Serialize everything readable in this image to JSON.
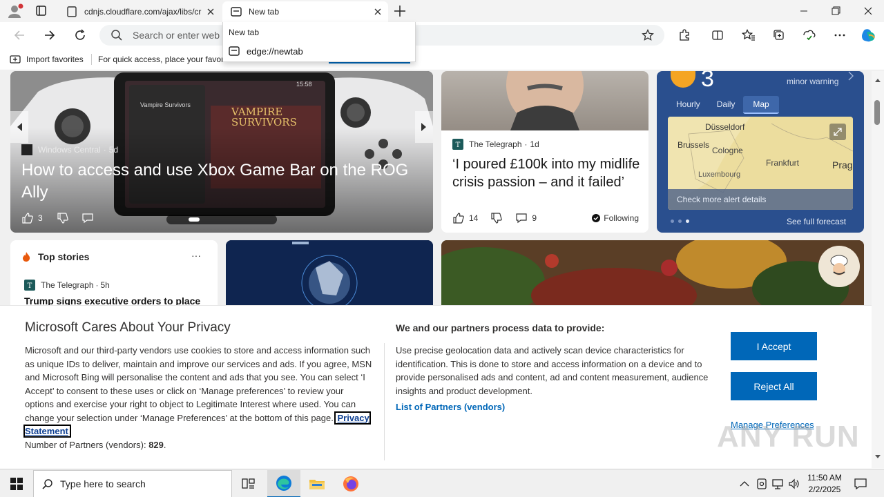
{
  "tabs": [
    {
      "title": "cdnjs.cloudflare.com/ajax/libs/cr",
      "favicon": "page-icon"
    },
    {
      "title": "New tab",
      "favicon": "newtab-icon"
    }
  ],
  "address": {
    "placeholder": "Search or enter web"
  },
  "dropdown": {
    "title": "New tab",
    "item": "edge://newtab"
  },
  "favorites": {
    "import": "Import favorites",
    "hint": "For quick access, place your favori"
  },
  "hero": {
    "source": "Windows Central",
    "age": "5d",
    "title": "How to access and use Xbox Game Bar on the ROG Ally",
    "likes": "3",
    "screen_title": "VAMPIRE SURVIVORS",
    "time": "15:58"
  },
  "telegraph_card": {
    "source": "The Telegraph",
    "age": "1d",
    "title": "‘I poured £100k into my midlife crisis passion – and it failed’",
    "likes": "14",
    "comments": "9",
    "following": "Following"
  },
  "weather": {
    "temp": "3",
    "warning": "minor warning",
    "tabs": [
      "Hourly",
      "Daily",
      "Map"
    ],
    "active_tab": "Map",
    "cities": [
      "Düsseldorf",
      "Brussels",
      "Cologne",
      "Frankfurt",
      "Prag",
      "Luxembourg"
    ],
    "alert": "Check more alert details",
    "forecast": "See full forecast"
  },
  "top_stories": {
    "title": "Top stories",
    "more": "···",
    "source": "The Telegraph",
    "age": "5h",
    "headline": "Trump signs executive orders to place"
  },
  "privacy": {
    "title": "Microsoft Cares About Your Privacy",
    "body": "Microsoft and our third-party vendors use cookies to store and access information such as unique IDs to deliver, maintain and improve our services and ads. If you agree, MSN and Microsoft Bing will personalise the content and ads that you see. You can select ‘I Accept’ to consent to these uses or click on ‘Manage preferences’ to review your options and exercise your right to object to Legitimate Interest where used.  You can change your selection under ‘Manage Preferences’ at the bottom of this page.",
    "privacy_link": "Privacy Statement",
    "partners_label": "Number of Partners (vendors):",
    "partners_count": "829",
    "partners_suffix": ".",
    "heading2": "We and our partners process data to provide:",
    "text2": "Use precise geolocation data and actively scan device characteristics for identification. This is done to store and access information on a device and to provide personalised ads and content, ad and content measurement, audience insights and product development.",
    "list_link": "List of Partners (vendors)",
    "accept": "I Accept",
    "reject": "Reject All",
    "manage": "Manage Preferences"
  },
  "taskbar": {
    "search_placeholder": "Type here to search",
    "time": "11:50 AM",
    "date": "2/2/2025"
  },
  "watermark": "ANY RUN",
  "colors": {
    "accent": "#0067b8",
    "weather_bg": "#2a4f8e",
    "taskbar": "#f0f0f0"
  }
}
